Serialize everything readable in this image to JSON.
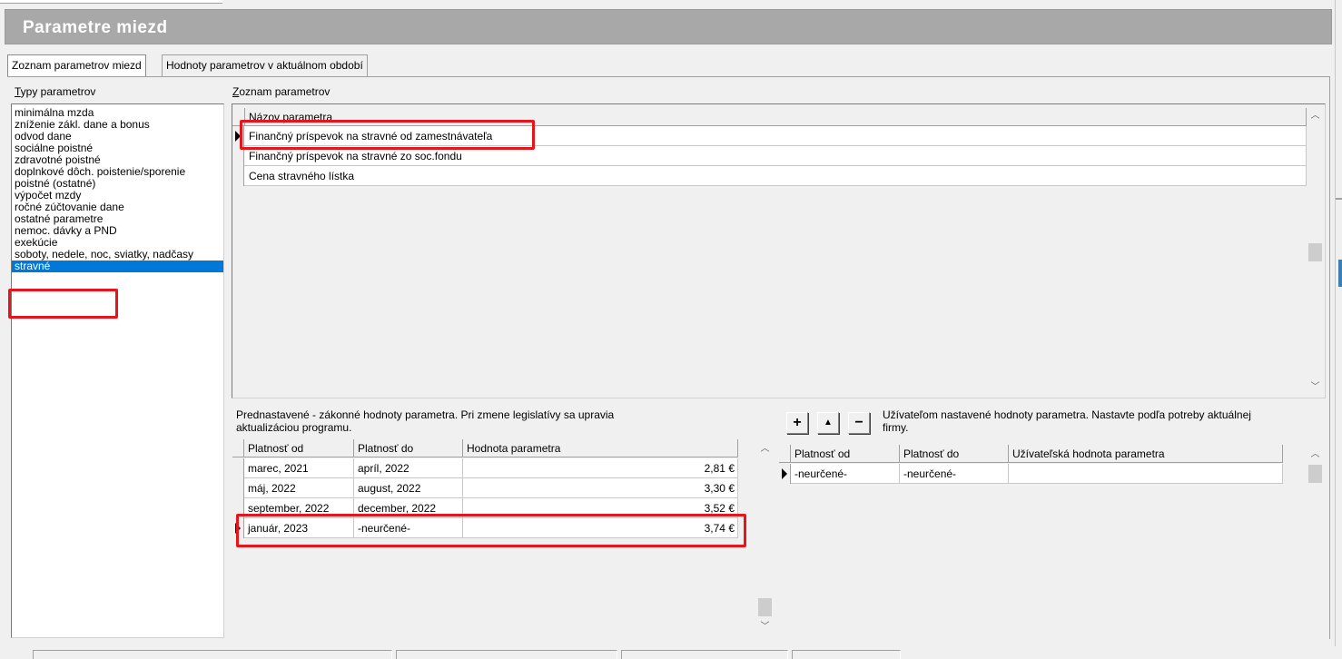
{
  "window": {
    "title": "Parametre miezd"
  },
  "tabs": [
    {
      "label": "Zoznam parametrov miezd",
      "active": true
    },
    {
      "label": "Hodnoty parametrov v aktuálnom období",
      "active": false
    }
  ],
  "left_panel": {
    "label_underlined": "T",
    "label_rest": "ypy parametrov",
    "items": [
      "minimálna mzda",
      "zníženie zákl. dane a bonus",
      "odvod dane",
      "sociálne poistné",
      "zdravotné poistné",
      "doplnkové dôch. poistenie/sporenie",
      "poistné (ostatné)",
      "výpočet mzdy",
      "ročné zúčtovanie dane",
      "ostatné parametre",
      "nemoc. dávky a PND",
      "exekúcie",
      "soboty, nedele, noc, sviatky, nadčasy",
      "stravné"
    ],
    "selected": "stravné"
  },
  "param_list": {
    "label_underlined": "Z",
    "label_rest": "oznam parametrov",
    "column": "Názov parametra",
    "rows": [
      "Finančný príspevok na stravné od zamestnávateľa",
      "Finančný príspevok na stravné zo soc.fondu",
      "Cena stravného lístka"
    ],
    "current_row": 0
  },
  "legal_values": {
    "description": "Prednastavené - zákonné hodnoty parametra. Pri zmene legislatívy sa upravia aktualizáciou programu.",
    "columns": [
      "Platnosť od",
      "Platnosť do",
      "Hodnota parametra"
    ],
    "rows": [
      {
        "from": "marec, 2021",
        "to": "apríl, 2022",
        "value": "2,81 €"
      },
      {
        "from": "máj, 2022",
        "to": "august, 2022",
        "value": "3,30 €"
      },
      {
        "from": "september, 2022",
        "to": "december, 2022",
        "value": "3,52 €"
      },
      {
        "from": "január, 2023",
        "to": "-neurčené-",
        "value": "3,74 €"
      }
    ],
    "current_row": 3
  },
  "user_values": {
    "description": "Užívateľom nastavené hodnoty parametra. Nastavte podľa potreby aktuálnej firmy.",
    "buttons": {
      "add": "+",
      "edit": "▲",
      "remove": "−"
    },
    "columns": [
      "Platnosť od",
      "Platnosť do",
      "Užívateľská hodnota parametra"
    ],
    "rows": [
      {
        "from": "-neurčené-",
        "to": "-neurčené-",
        "value": ""
      }
    ]
  },
  "colors": {
    "title_bar": "#a8a8a8",
    "selection": "#0078d7",
    "highlight": "#e8141b"
  }
}
